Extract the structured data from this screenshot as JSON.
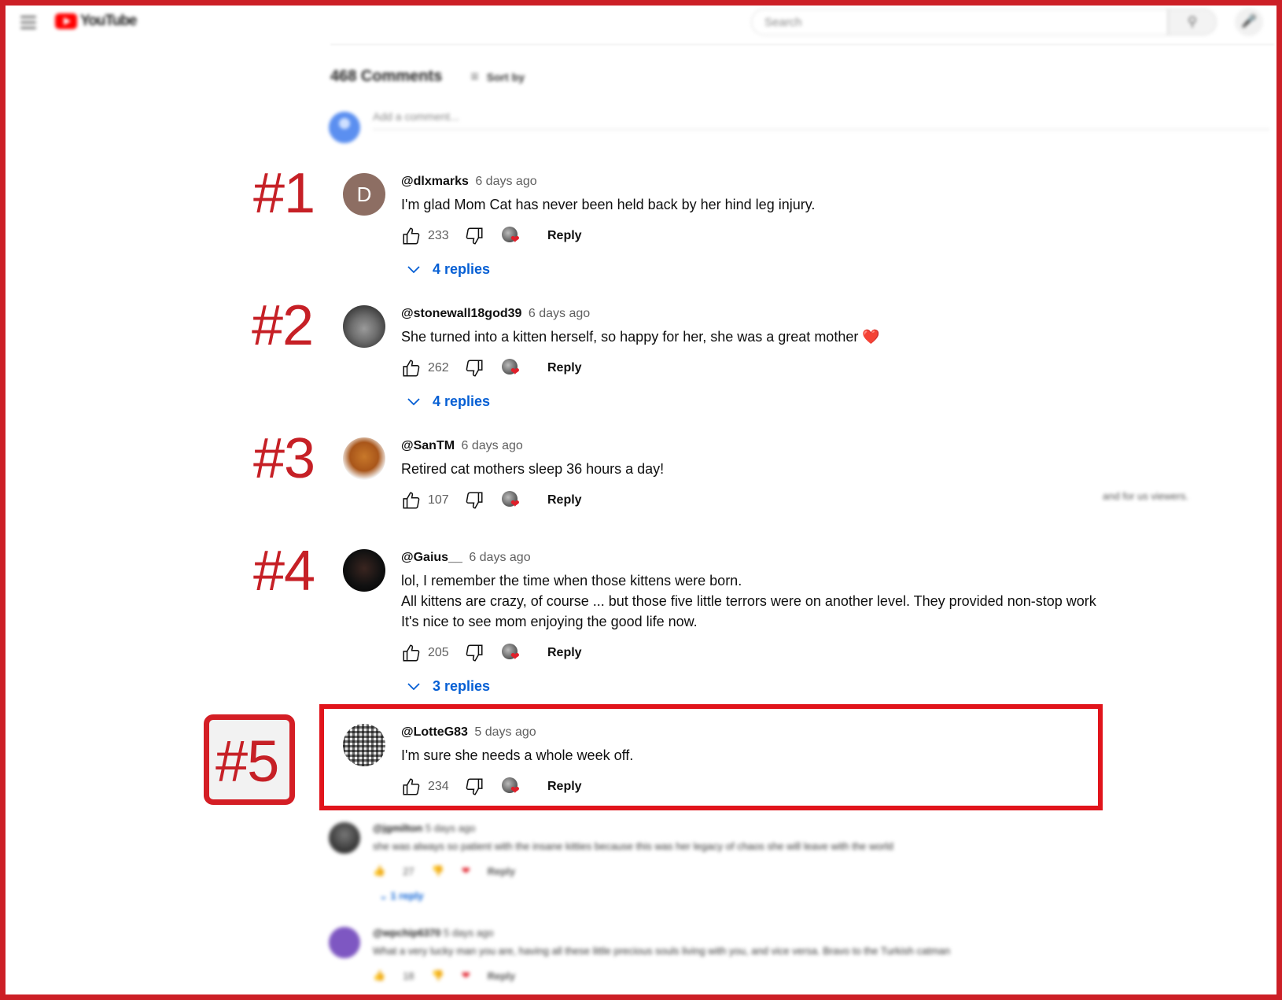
{
  "header": {
    "logo_text": "YouTube",
    "search_placeholder": "Search"
  },
  "comments_section": {
    "count_label": "468 Comments",
    "sort_label": "Sort by",
    "add_comment_placeholder": "Add a comment..."
  },
  "ranks": [
    "#1",
    "#2",
    "#3",
    "#4",
    "#5"
  ],
  "comments": [
    {
      "author": "@dlxmarks",
      "time": "6 days ago",
      "text": "I'm glad Mom Cat has never been held back by her hind leg injury.",
      "likes": "233",
      "reply_label": "Reply",
      "replies_label": "4 replies",
      "avatar_letter": "D"
    },
    {
      "author": "@stonewall18god39",
      "time": "6 days ago",
      "text": "She turned into a kitten herself, so happy for her, she was a great mother ❤️",
      "likes": "262",
      "reply_label": "Reply",
      "replies_label": "4 replies"
    },
    {
      "author": "@SanTM",
      "time": "6 days ago",
      "text": "Retired cat mothers sleep 36 hours a day!",
      "likes": "107",
      "reply_label": "Reply"
    },
    {
      "author": "@Gaius__",
      "time": "6 days ago",
      "text": "lol, I remember the time when those kittens were born.\nAll kittens are crazy, of course ... but those five little terrors were on another level. They provided non-stop work\nIt's nice to see mom enjoying the good life now.",
      "likes": "205",
      "reply_label": "Reply",
      "replies_label": "3 replies"
    },
    {
      "author": "@LotteG83",
      "time": "5 days ago",
      "text": "I'm sure she needs a whole week off.",
      "likes": "234",
      "reply_label": "Reply"
    }
  ],
  "blurred_comments": [
    {
      "author": "@jgmilton",
      "time": "5 days ago",
      "text": "she was always so patient with the insane kitties because this was her legacy of chaos she will leave with the world",
      "likes": "27",
      "reply_label": "Reply",
      "replies_label": "1 reply"
    },
    {
      "author": "@wpchip6370",
      "time": "5 days ago",
      "text": "What a very lucky man you are, having all these little precious souls living with you, and vice versa. Bravo to the Turkish catman",
      "likes": "18",
      "reply_label": "Reply"
    }
  ],
  "side_note": "and for us viewers.",
  "colors": {
    "frame": "#cc1f26",
    "highlight_box": "#e1141b",
    "rank_text": "#c62026",
    "link_blue": "#065fd4",
    "heart": "#e01f2a"
  }
}
